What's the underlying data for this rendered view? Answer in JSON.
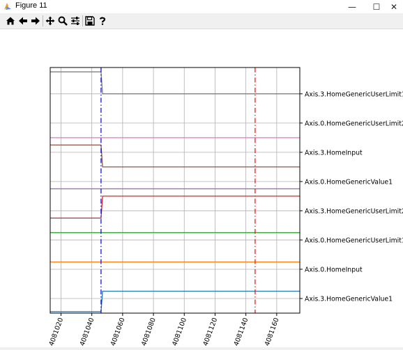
{
  "window": {
    "title": "Figure 11",
    "minimize_glyph": "—",
    "maximize_glyph": "☐",
    "close_glyph": "✕"
  },
  "toolbar": {
    "buttons": [
      {
        "name": "home-button",
        "icon": "home-icon",
        "tooltip": "Reset original view"
      },
      {
        "name": "back-button",
        "icon": "arrow-left-icon",
        "tooltip": "Back to previous view"
      },
      {
        "name": "forward-button",
        "icon": "arrow-right-icon",
        "tooltip": "Forward to next view"
      },
      {
        "name": "pan-button",
        "icon": "move-icon",
        "tooltip": "Pan axes"
      },
      {
        "name": "zoom-button",
        "icon": "magnifier-icon",
        "tooltip": "Zoom to rectangle"
      },
      {
        "name": "configure-subplots-button",
        "icon": "sliders-icon",
        "tooltip": "Configure subplots"
      },
      {
        "name": "save-button",
        "icon": "floppy-disk-icon",
        "tooltip": "Save the figure"
      },
      {
        "name": "help-button",
        "icon": "question-icon",
        "tooltip": "Help"
      }
    ]
  },
  "chart_data": {
    "type": "line",
    "title": "",
    "xlabel": "",
    "ylabel": "",
    "xlim": [
      4081013,
      4081175
    ],
    "ylim": [
      -0.5,
      7.9
    ],
    "grid": true,
    "x_ticks": [
      4081020,
      4081040,
      4081060,
      4081080,
      4081100,
      4081120,
      4081140,
      4081160
    ],
    "x_tick_labels": [
      "4081020",
      "4081040",
      "4081060",
      "4081080",
      "4081100",
      "4081120",
      "4081140",
      "4081160"
    ],
    "y_ticks": [
      0,
      1,
      2,
      3,
      4,
      5,
      6,
      7
    ],
    "y_tick_labels": [
      "Axis.3.HomeGenericValue1",
      "Axis.0.HomeInput",
      "Axis.0.HomeGenericUserLimit1",
      "Axis.3.HomeGenericUserLimit2",
      "Axis.0.HomeGenericValue1",
      "Axis.3.HomeInput",
      "Axis.0.HomeGenericUserLimit2",
      "Axis.3.HomeGenericUserLimit1"
    ],
    "series": [
      {
        "color": "#1f77b4",
        "x": [
          4081013,
          4081046,
          4081047,
          4081175
        ],
        "y": [
          -0.45,
          -0.45,
          0.25,
          0.25
        ]
      },
      {
        "color": "#ff7f0e",
        "x": [
          4081013,
          4081175
        ],
        "y": [
          1.25,
          1.25
        ]
      },
      {
        "color": "#2ca02c",
        "x": [
          4081013,
          4081175
        ],
        "y": [
          2.25,
          2.25
        ]
      },
      {
        "color": "#d62728",
        "x": [
          4081013,
          4081046,
          4081047,
          4081175
        ],
        "y": [
          2.75,
          2.75,
          3.5,
          3.5
        ]
      },
      {
        "color": "#9467bd",
        "x": [
          4081013,
          4081175
        ],
        "y": [
          3.75,
          3.75
        ]
      },
      {
        "color": "#8c564b",
        "x": [
          4081013,
          4081046,
          4081047,
          4081175
        ],
        "y": [
          5.25,
          5.25,
          4.5,
          4.5
        ]
      },
      {
        "color": "#e377c2",
        "x": [
          4081013,
          4081175
        ],
        "y": [
          5.5,
          5.5
        ]
      },
      {
        "color": "#7f7f7f",
        "x": [
          4081013,
          4081046,
          4081047,
          4081175
        ],
        "y": [
          7.75,
          7.75,
          7.0,
          7.0
        ]
      }
    ],
    "vlines": [
      {
        "x": 4081046,
        "color": "#0000cc",
        "style": "dash-dot"
      },
      {
        "x": 4081146,
        "color": "#ff0000",
        "style": "dash-dot"
      }
    ]
  }
}
